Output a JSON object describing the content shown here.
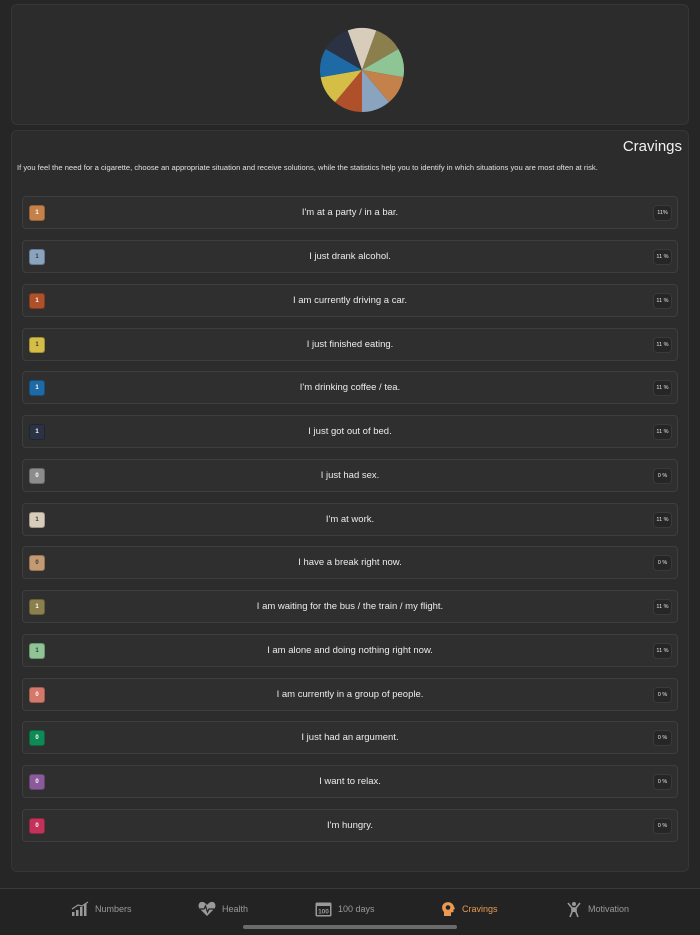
{
  "cravings": {
    "title": "Cravings",
    "description": "If you feel the need for a cigarette, choose an appropriate situation and receive solutions, while the statistics help you to identify in which situations you are most often at risk.",
    "items": [
      {
        "label": "I'm at a party / in a bar.",
        "count": "1",
        "percent": "11%",
        "color": "#c4824a"
      },
      {
        "label": "I just drank alcohol.",
        "count": "1",
        "percent": "11 %",
        "color": "#8aa3be"
      },
      {
        "label": "I am currently driving a car.",
        "count": "1",
        "percent": "11 %",
        "color": "#b0502b"
      },
      {
        "label": "I just finished eating.",
        "count": "1",
        "percent": "11 %",
        "color": "#d4be45"
      },
      {
        "label": "I'm drinking coffee / tea.",
        "count": "1",
        "percent": "11 %",
        "color": "#1d6aa6"
      },
      {
        "label": "I just got out of bed.",
        "count": "1",
        "percent": "11 %",
        "color": "#2b3244"
      },
      {
        "label": "I just had sex.",
        "count": "0",
        "percent": "0 %",
        "color": "#8c8c8c"
      },
      {
        "label": "I'm at work.",
        "count": "1",
        "percent": "11 %",
        "color": "#d8cdbb"
      },
      {
        "label": "I have a break right now.",
        "count": "0",
        "percent": "0 %",
        "color": "#c49a72"
      },
      {
        "label": "I am waiting for the bus / the train / my flight.",
        "count": "1",
        "percent": "11 %",
        "color": "#8a7f4d"
      },
      {
        "label": "I am alone and doing nothing right now.",
        "count": "1",
        "percent": "11 %",
        "color": "#8fc495"
      },
      {
        "label": "I am currently in a group of people.",
        "count": "0",
        "percent": "0 %",
        "color": "#d4786a"
      },
      {
        "label": "I just had an argument.",
        "count": "0",
        "percent": "0 %",
        "color": "#0f8a57"
      },
      {
        "label": "I want to relax.",
        "count": "0",
        "percent": "0 %",
        "color": "#8a5a9a"
      },
      {
        "label": "I'm hungry.",
        "count": "0",
        "percent": "0 %",
        "color": "#c2325b"
      }
    ]
  },
  "pie": {
    "slices": [
      {
        "name": "I'm at work.",
        "value": 11,
        "color": "#d8cdbb"
      },
      {
        "name": "I am waiting for the bus / the train / my flight.",
        "value": 11,
        "color": "#8a7f4d"
      },
      {
        "name": "I am alone and doing nothing right now.",
        "value": 11,
        "color": "#8fc495"
      },
      {
        "name": "I'm at a party / in a bar.",
        "value": 11,
        "color": "#c4824a"
      },
      {
        "name": "I just drank alcohol.",
        "value": 11,
        "color": "#8aa3be"
      },
      {
        "name": "I am currently driving a car.",
        "value": 11,
        "color": "#b0502b"
      },
      {
        "name": "I just finished eating.",
        "value": 11,
        "color": "#d4be45"
      },
      {
        "name": "I'm drinking coffee / tea.",
        "value": 11,
        "color": "#1d6aa6"
      },
      {
        "name": "I just got out of bed.",
        "value": 11,
        "color": "#2b3244"
      }
    ]
  },
  "tabs": [
    {
      "label": "Numbers",
      "icon": "chart-icon",
      "active": false
    },
    {
      "label": "Health",
      "icon": "heart-icon",
      "active": false
    },
    {
      "label": "100 days",
      "icon": "calendar-icon",
      "active": false
    },
    {
      "label": "Cravings",
      "icon": "head-icon",
      "active": true
    },
    {
      "label": "Motivation",
      "icon": "person-icon",
      "active": false
    }
  ],
  "colors": {
    "accent": "#e89a52",
    "inactive_tab": "#9a9a9a",
    "background": "#262626"
  }
}
